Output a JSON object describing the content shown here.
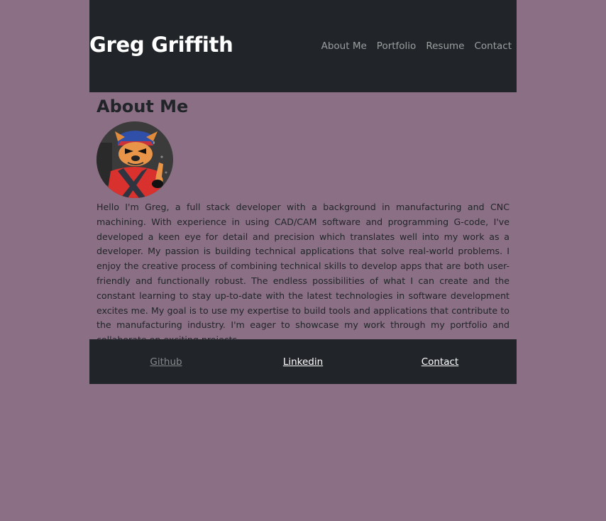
{
  "header": {
    "brand": "Greg Griffith",
    "nav": [
      {
        "label": "About Me"
      },
      {
        "label": "Portfolio"
      },
      {
        "label": "Resume"
      },
      {
        "label": "Contact"
      }
    ]
  },
  "about": {
    "title": "About Me",
    "avatar_icon": "cartoon-cat-pilot-avatar",
    "bio": "Hello I'm Greg, a full stack developer with a background in manufacturing and CNC machining. With experience in using CAD/CAM software and programming G-code, I've developed a keen eye for detail and precision which translates well into my work as a developer. My passion is building technical applications that solve real-world problems. I enjoy the creative process of combining technical skills to develop apps that are both user-friendly and functionally robust. The endless possibilities of what I can create and the constant learning to stay up-to-date with the latest technologies in software development excites me. My goal is to use my expertise to build tools and applications that contribute to the manufacturing industry. I'm eager to showcase my work through my portfolio and collaborate on exciting projects."
  },
  "footer": {
    "links": [
      {
        "label": "Github"
      },
      {
        "label": "Linkedin"
      },
      {
        "label": "Contact"
      }
    ]
  },
  "colors": {
    "page_background": "#8b7085",
    "header_background": "#212529",
    "text": "#212529"
  }
}
